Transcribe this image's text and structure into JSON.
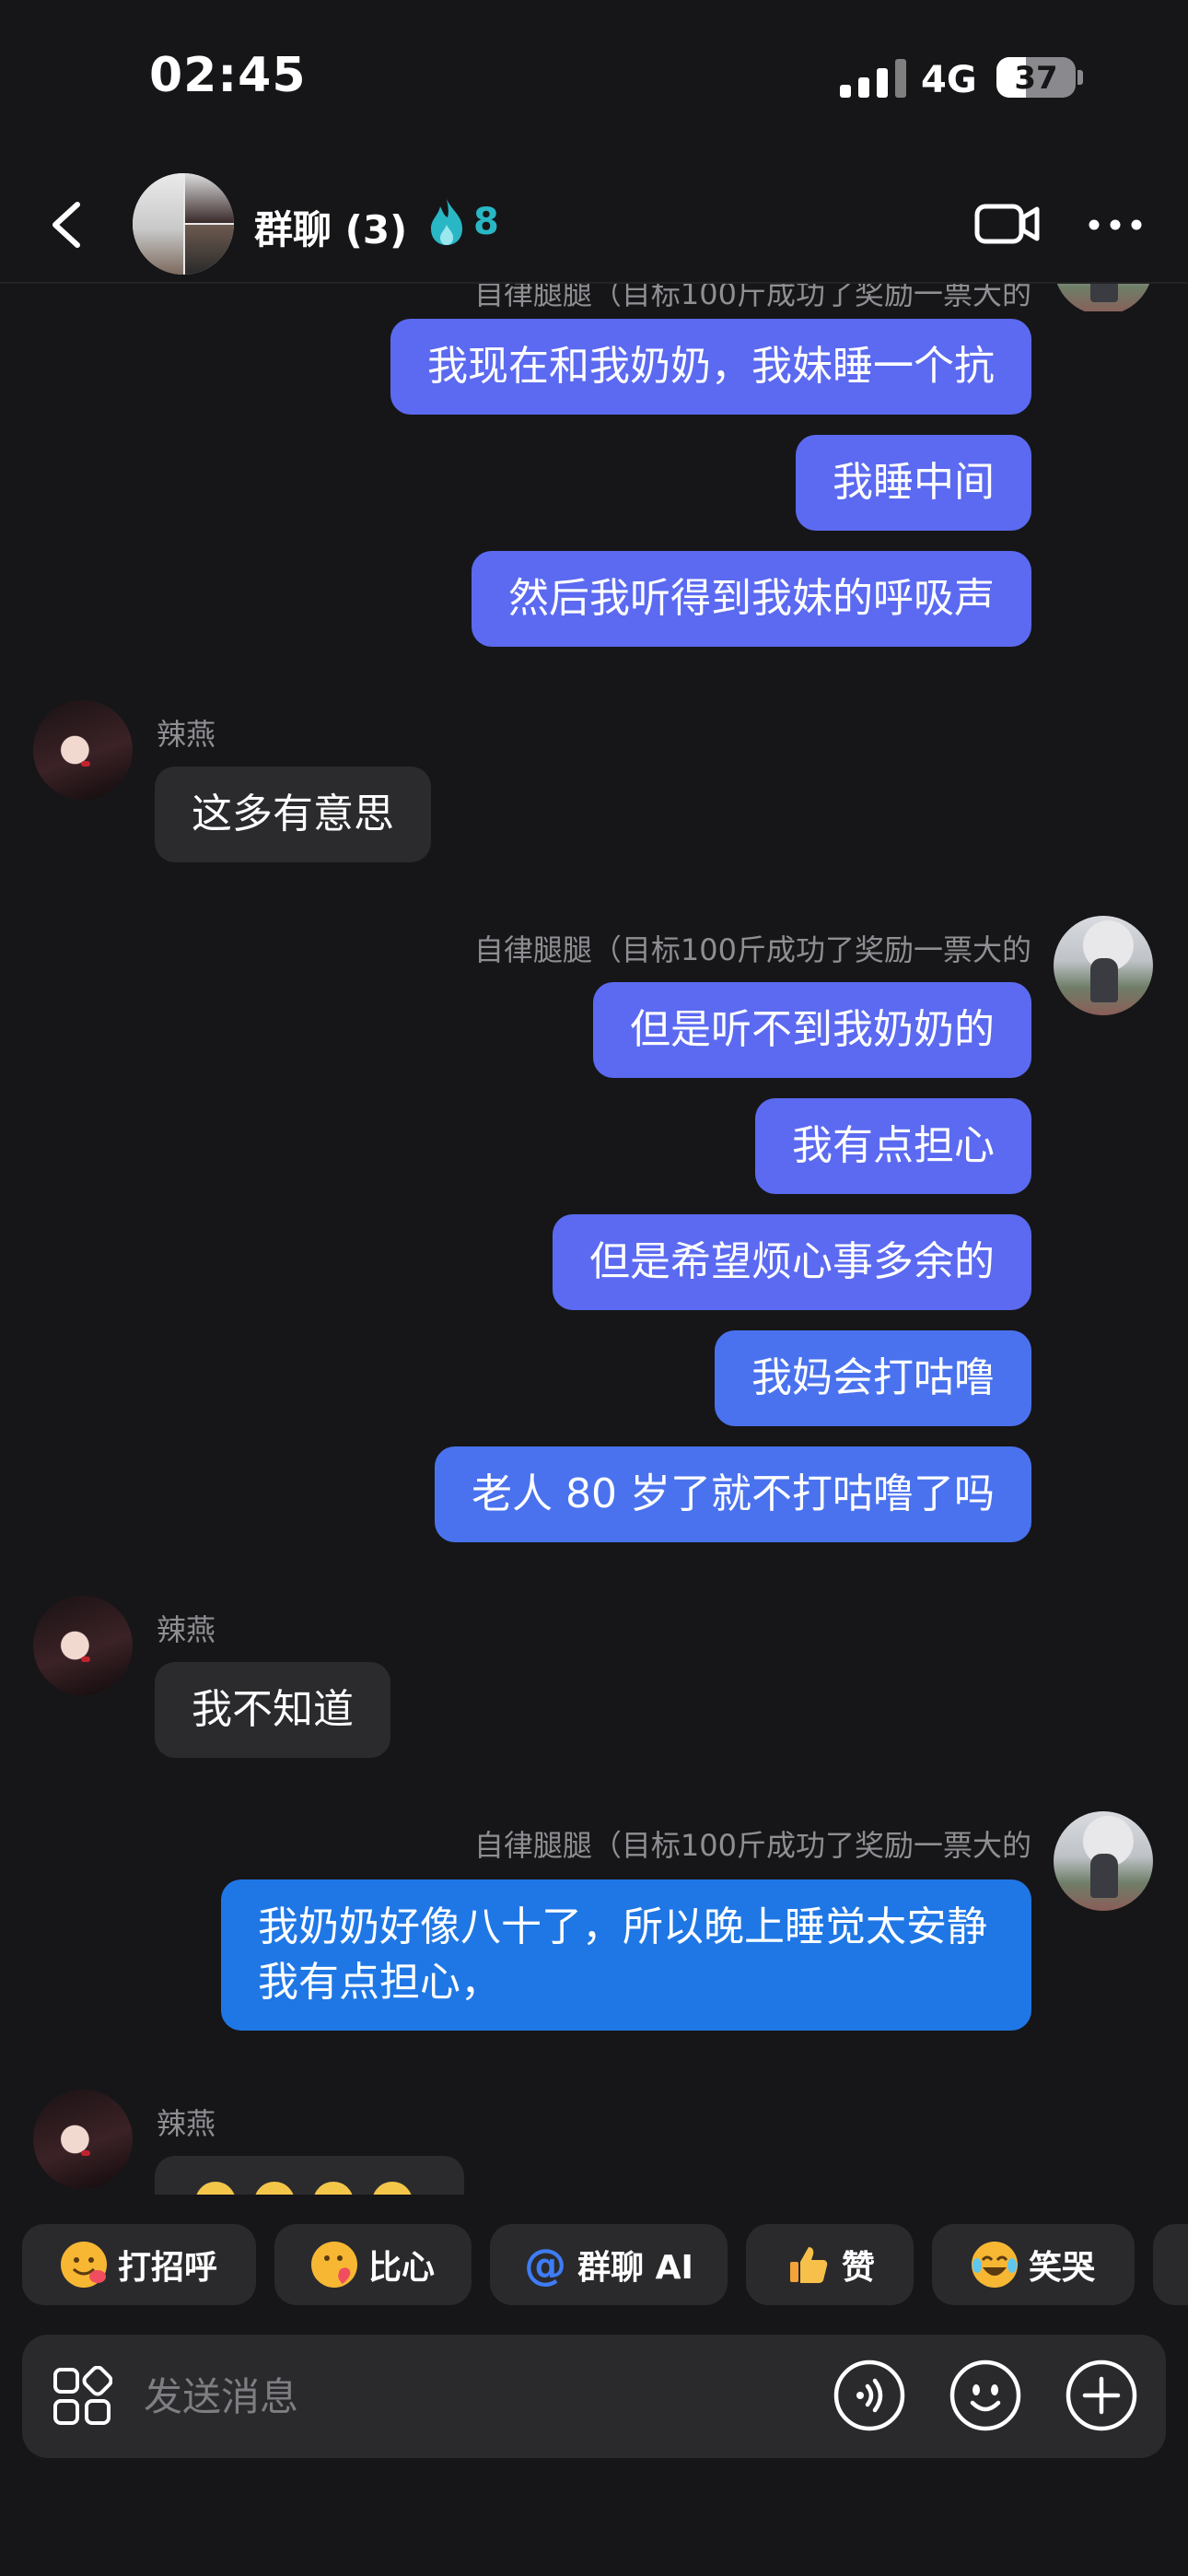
{
  "status_bar": {
    "time": "02:45",
    "network": "4G",
    "battery": "37",
    "battery_level": 0.37
  },
  "header": {
    "title": "群聊 (3)",
    "fire_count": "8"
  },
  "messages": {
    "partial_sender_name": "自律腿腿（目标100斤成功了奖励一票大的",
    "m1": "我现在和我奶奶，我妹睡一个抗",
    "m2": "我睡中间",
    "m3": "然后我听得到我妹的呼吸声",
    "name2": "辣燕",
    "m4": "这多有意思",
    "name3": "自律腿腿（目标100斤成功了奖励一票大的",
    "m5": "但是听不到我奶奶的",
    "m6": "我有点担心",
    "m7": "但是希望烦心事多余的",
    "m8": "我妈会打咕噜",
    "m9": "老人 80 岁了就不打咕噜了吗",
    "name4": "辣燕",
    "m10": "我不知道",
    "name5": "自律腿腿（目标100斤成功了奖励一票大的",
    "m11": "我奶奶好像八十了，所以晚上睡觉太安静我有点担心，",
    "name6": "辣燕"
  },
  "quick_replies": [
    {
      "label": "打招呼",
      "icon": "greeting-emoji-icon"
    },
    {
      "label": "比心",
      "icon": "heart-hand-emoji-icon"
    },
    {
      "label": "群聊 AI",
      "icon": "at-icon"
    },
    {
      "label": "赞",
      "icon": "thumbs-up-icon"
    },
    {
      "label": "笑哭",
      "icon": "laugh-cry-emoji-icon"
    }
  ],
  "composer": {
    "placeholder": "发送消息"
  },
  "colors": {
    "background": "#161618",
    "my_bubble": "#5b6af0",
    "my_bubble_blue": "#1f77e5",
    "their_bubble": "#2b2b2e",
    "fire": "#2ab7c5"
  }
}
